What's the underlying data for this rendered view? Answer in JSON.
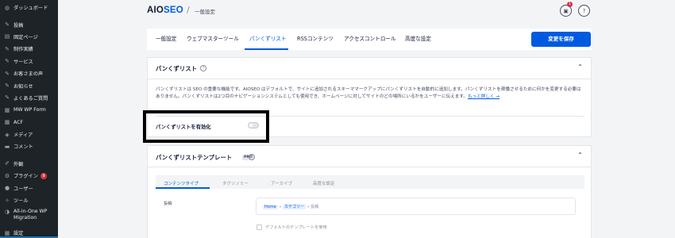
{
  "sidebar": {
    "items": [
      {
        "label": "ダッシュボード",
        "icon": "dashboard-icon",
        "glyph": "◍"
      },
      {
        "label": "投稿",
        "icon": "pin-icon",
        "glyph": "✎"
      },
      {
        "label": "固定ページ",
        "icon": "page-icon",
        "glyph": "▤"
      },
      {
        "label": "制作実績",
        "icon": "pin-icon",
        "glyph": "✎"
      },
      {
        "label": "サービス",
        "icon": "pin-icon",
        "glyph": "✎"
      },
      {
        "label": "お客さまの声",
        "icon": "pin-icon",
        "glyph": "✎"
      },
      {
        "label": "お知らせ",
        "icon": "pin-icon",
        "glyph": "✎"
      },
      {
        "label": "よくあるご質問",
        "icon": "pin-icon",
        "glyph": "✎"
      },
      {
        "label": "MW WP Form",
        "icon": "form-icon",
        "glyph": "▦"
      },
      {
        "label": "ACF",
        "icon": "acf-icon",
        "glyph": "▦"
      },
      {
        "label": "メディア",
        "icon": "media-icon",
        "glyph": "◈"
      },
      {
        "label": "コメント",
        "icon": "comment-icon",
        "glyph": "▬"
      },
      {
        "label": "外観",
        "icon": "appearance-icon",
        "glyph": "✐"
      },
      {
        "label": "プラグイン",
        "icon": "plugin-icon",
        "glyph": "⚙",
        "badge": "9"
      },
      {
        "label": "ユーザー",
        "icon": "user-icon",
        "glyph": "●"
      },
      {
        "label": "ツール",
        "icon": "tool-icon",
        "glyph": "✧"
      },
      {
        "label": "All-in-One WP Migration",
        "icon": "migration-icon",
        "glyph": "◑"
      },
      {
        "label": "設定",
        "icon": "settings-icon",
        "glyph": "▦"
      }
    ]
  },
  "header": {
    "logo_main": "AIO",
    "logo_accent": "SEO",
    "separator": "/",
    "page": "一般設定",
    "notification_count": "1",
    "inbox_glyph": "▣",
    "help_glyph": "?"
  },
  "tabs": {
    "items": [
      {
        "label": "一般設定"
      },
      {
        "label": "ウェブマスターツール"
      },
      {
        "label": "パンくずリスト"
      },
      {
        "label": "RSSコンテンツ"
      },
      {
        "label": "アクセスコントロール"
      },
      {
        "label": "高度な設定"
      }
    ],
    "active": "パンくずリスト",
    "save_label": "変更を保存"
  },
  "breadcrumbs_card": {
    "title": "パンくずリスト",
    "help_glyph": "?",
    "chevron": "⌃",
    "description": "パンくずリストは SEO の重要な機能です。AIOSEO はデフォルトで、サイトに追加されるスキーママークアップにパンくずリストを自動的に追加します。パンくずリストを稼働させるために何かを変更する必要はありません。パンくずリストは2つ目のナビゲーションシステムとしても使用でき、ホームページに対してサイトのどの場所にいるかをユーザーに伝えます。",
    "learn_more": "もっと詳しく →",
    "enable_label": "パンくずリストを有効化",
    "enabled": false
  },
  "template_card": {
    "title": "パンくずリストテンプレート",
    "pro_badge": "PRO",
    "help_glyph": "?",
    "chevron": "⌃",
    "sub_tabs": [
      {
        "label": "コンテンツタイプ"
      },
      {
        "label": "タクソノミー"
      },
      {
        "label": "アーカイブ"
      },
      {
        "label": "高度な設定"
      }
    ],
    "row_label": "投稿",
    "crumb_home": "Home",
    "crumb_sep": "»",
    "crumb_category": "カテゴリー",
    "crumb_post": "投稿",
    "default_template_label": "デフォルトのテンプレートを使用"
  },
  "colors": {
    "accent": "#005ae0",
    "sidebar_bg": "#1d2327",
    "highlight": "#000000"
  }
}
